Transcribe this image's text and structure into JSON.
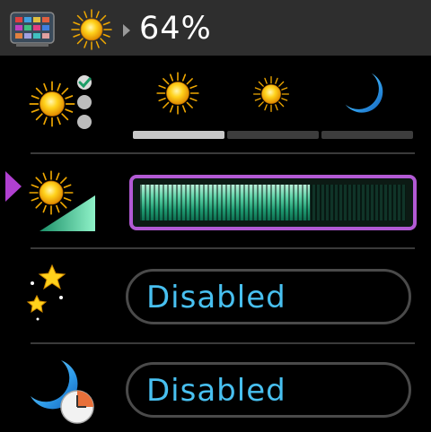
{
  "header": {
    "brightness_text": "64%",
    "icons": [
      "app-grid-icon",
      "sun-icon",
      "breadcrumb-arrow-icon"
    ]
  },
  "mode_row": {
    "icon": "sun-mode-icon",
    "options": [
      "sun-large-icon",
      "sun-small-icon",
      "moon-icon"
    ],
    "selected_index": 0
  },
  "brightness_row": {
    "icon": "brightness-ramp-icon",
    "level": 0.64,
    "accent_color": "#b25ad4"
  },
  "night_row": {
    "icon": "night-stars-icon",
    "value": "Disabled"
  },
  "night_timer_row": {
    "icon": "night-timer-icon",
    "value": "Disabled"
  },
  "colors": {
    "header_bg": "#2e2e2e",
    "value_text": "#48c0f0",
    "selector": "#b040d0"
  }
}
